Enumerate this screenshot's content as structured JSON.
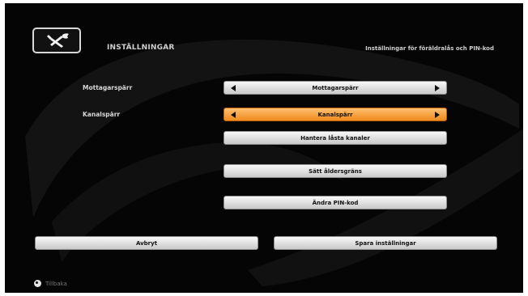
{
  "header": {
    "title": "INSTÄLLNINGAR",
    "subtitle": "Inställningar för föräldralås och PIN-kod",
    "icon": "tools-icon"
  },
  "settings": {
    "rows": [
      {
        "label": "Mottagarspärr",
        "value": "Mottagarspärr",
        "selected": false
      },
      {
        "label": "Kanalspärr",
        "value": "Kanalspärr",
        "selected": true
      }
    ],
    "buttons": [
      "Hantera låsta kanaler",
      "Sätt åldersgräns",
      "Ändra PIN-kod"
    ]
  },
  "footer": {
    "cancel_label": "Avbryt",
    "save_label": "Spara inställningar",
    "back_label": "Tillbaka"
  },
  "colors": {
    "background": "#050505",
    "button": "#d9d9d9",
    "selected": "#f08a1d",
    "text": "#d8d8d8"
  }
}
